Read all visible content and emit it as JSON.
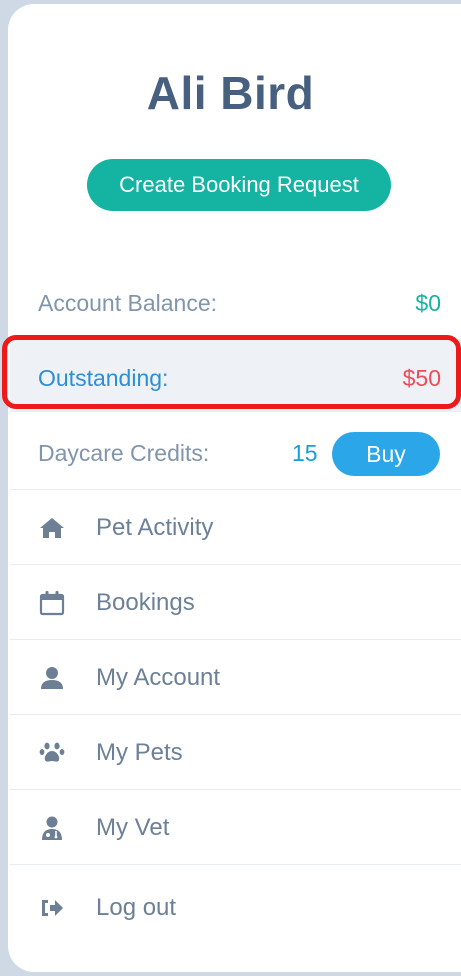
{
  "user": {
    "name": "Ali Bird"
  },
  "actions": {
    "create_booking_label": "Create Booking Request"
  },
  "account": {
    "balance_label": "Account Balance:",
    "balance_value": "$0",
    "outstanding_label": "Outstanding:",
    "outstanding_value": "$50",
    "credits_label": "Daycare Credits:",
    "credits_value": "15",
    "buy_label": "Buy"
  },
  "nav": {
    "items": [
      {
        "label": "Pet Activity",
        "icon": "home-icon"
      },
      {
        "label": "Bookings",
        "icon": "calendar-icon"
      },
      {
        "label": "My Account",
        "icon": "user-icon"
      },
      {
        "label": "My Pets",
        "icon": "paw-icon"
      },
      {
        "label": "My Vet",
        "icon": "doctor-icon"
      },
      {
        "label": "Log out",
        "icon": "logout-icon"
      }
    ]
  },
  "colors": {
    "title": "#48607f",
    "accent_teal": "#15b3a1",
    "accent_blue": "#2ba6e8",
    "outstanding_red": "#f04a58",
    "highlight_red": "#ee1a1a",
    "icon_gray": "#6c7f94"
  }
}
